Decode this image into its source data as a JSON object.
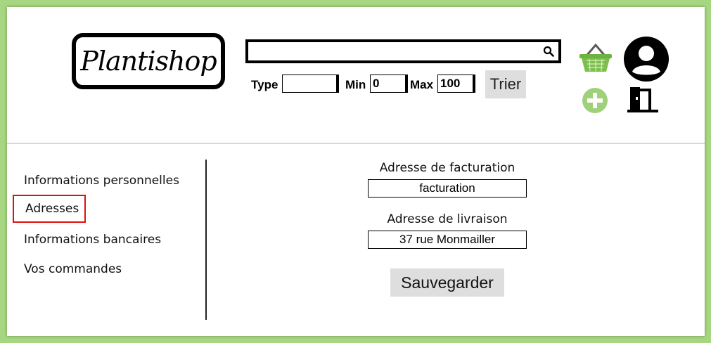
{
  "header": {
    "logo_text": "Plantishop",
    "search": {
      "value": "",
      "placeholder": ""
    },
    "filters": {
      "type_label": "Type",
      "type_value": "",
      "min_label": "Min",
      "min_value": "0",
      "max_label": "Max",
      "max_value": "100",
      "sort_button": "Trier"
    },
    "icons": [
      "basket-icon",
      "user-icon",
      "add-icon",
      "logout-door-icon"
    ]
  },
  "sidebar": {
    "items": [
      {
        "label": "Informations personnelles",
        "active": false
      },
      {
        "label": "Adresses",
        "active": true
      },
      {
        "label": "Informations bancaires",
        "active": false
      },
      {
        "label": "Vos commandes",
        "active": false
      }
    ]
  },
  "form": {
    "billing_label": "Adresse de facturation",
    "billing_value": "facturation",
    "shipping_label": "Adresse de livraison",
    "shipping_value": "37 rue Monmailler",
    "save_button": "Sauvegarder"
  },
  "colors": {
    "background": "#a6d67f",
    "active_border": "#e01010",
    "basket_green": "#7cc04b",
    "plus_green": "#9fd07a"
  }
}
